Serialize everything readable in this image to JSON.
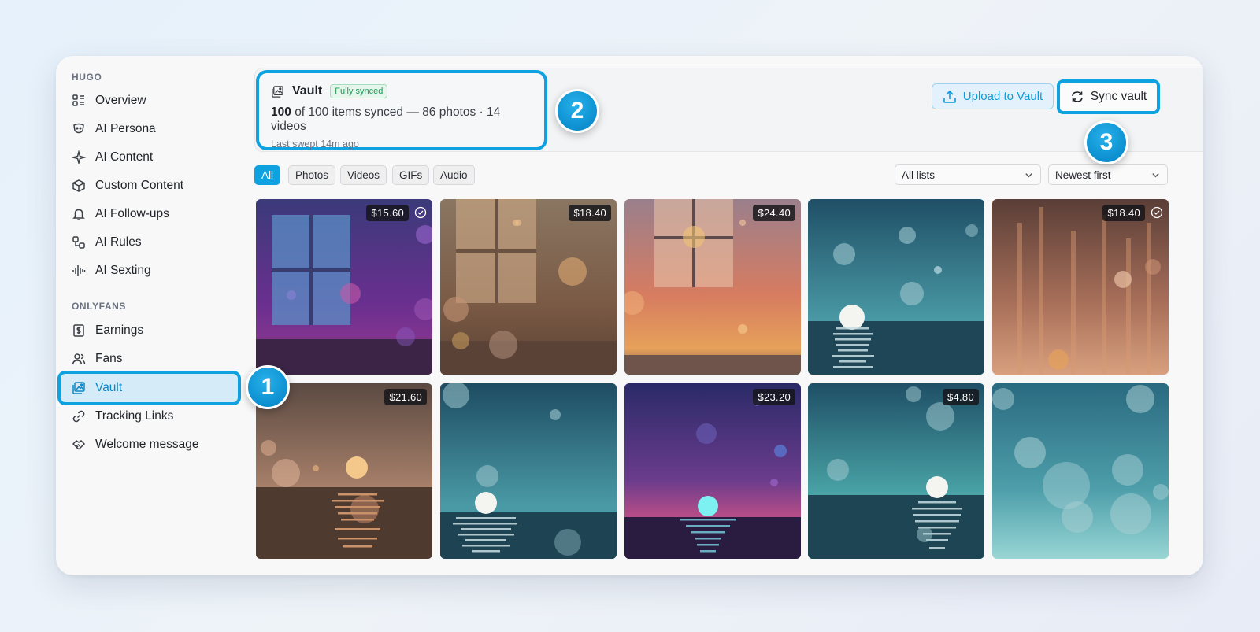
{
  "sidebar": {
    "section1": "HUGO",
    "section2": "ONLYFANS",
    "items": [
      {
        "label": "Overview",
        "icon": "overview-icon"
      },
      {
        "label": "AI Persona",
        "icon": "persona-icon"
      },
      {
        "label": "AI Content",
        "icon": "sparkle-icon"
      },
      {
        "label": "Custom Content",
        "icon": "box-icon"
      },
      {
        "label": "AI Follow-ups",
        "icon": "bell-icon"
      },
      {
        "label": "AI Rules",
        "icon": "rules-icon"
      },
      {
        "label": "AI Sexting",
        "icon": "waveform-icon"
      },
      {
        "label": "Earnings",
        "icon": "dollar-doc-icon"
      },
      {
        "label": "Fans",
        "icon": "users-icon"
      },
      {
        "label": "Vault",
        "icon": "image-icon"
      },
      {
        "label": "Tracking Links",
        "icon": "link-icon"
      },
      {
        "label": "Welcome message",
        "icon": "handshake-icon"
      }
    ]
  },
  "vault": {
    "title": "Vault",
    "badge": "Fully synced",
    "synced_count": "100",
    "sync_rest": "of 100 items synced — 86 photos · 14 videos",
    "swept": "Last swept 14m ago"
  },
  "actions": {
    "upload_label": "Upload to Vault",
    "sync_label": "Sync vault"
  },
  "markers": [
    "1",
    "2",
    "3"
  ],
  "filters": {
    "chips": [
      "All",
      "Photos",
      "Videos",
      "GIFs",
      "Audio"
    ],
    "list_select": "All lists",
    "sort_select": "Newest first"
  },
  "grid": [
    {
      "price": "$15.60",
      "checked": true
    },
    {
      "price": "$18.40",
      "checked": false
    },
    {
      "price": "$24.40",
      "checked": false
    },
    {
      "price": "",
      "checked": false
    },
    {
      "price": "$18.40",
      "checked": true
    },
    {
      "price": "$21.60",
      "checked": false
    },
    {
      "price": "",
      "checked": false
    },
    {
      "price": "$23.20",
      "checked": false
    },
    {
      "price": "$4.80",
      "checked": false
    },
    {
      "price": "",
      "checked": false
    }
  ],
  "colors": {
    "accent": "#0fa2e0",
    "synced_green": "#1e9b55"
  }
}
